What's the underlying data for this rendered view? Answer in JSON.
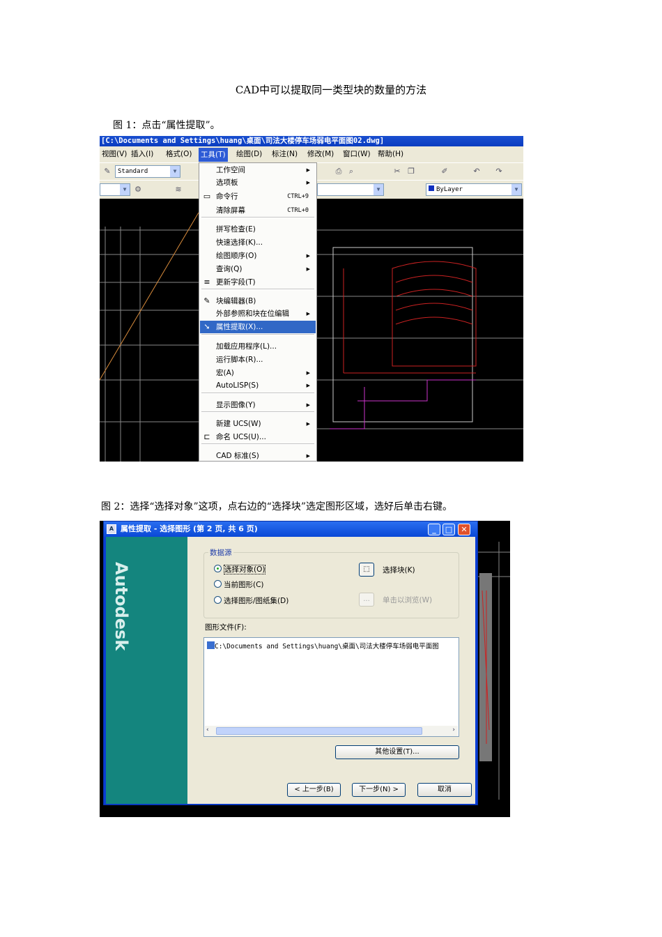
{
  "doc": {
    "title": "CAD中可以提取同一类型块的数量的方法",
    "caption1": "图 1：点击“属性提取”。",
    "caption2": "图 2：选择“选择对象”这项，点右边的“选择块”选定图形区域，选好后单击右键。"
  },
  "fig1": {
    "window_title": "[C:\\Documents and Settings\\huang\\桌面\\司法大楼停车场弱电平面图02.dwg]",
    "menubar": [
      "视图(V)",
      "插入(I)",
      "格式(O)",
      "工具(T)",
      "绘图(D)",
      "标注(N)",
      "修改(M)",
      "窗口(W)",
      "帮助(H)"
    ],
    "text_style": "Standard",
    "layer_color": "ByLayer",
    "menu": [
      {
        "label": "工作空间",
        "arrow": "▶"
      },
      {
        "label": "选项板",
        "arrow": "▶"
      },
      {
        "label": "命令行",
        "shortcut": "CTRL+9"
      },
      {
        "label": "清除屏幕",
        "shortcut": "CTRL+0"
      },
      {
        "label": "拼写检查(E)"
      },
      {
        "label": "快速选择(K)..."
      },
      {
        "label": "绘图顺序(O)",
        "arrow": "▶"
      },
      {
        "label": "查询(Q)",
        "arrow": "▶"
      },
      {
        "label": "更新字段(T)"
      },
      {
        "label": "块编辑器(B)"
      },
      {
        "label": "外部参照和块在位编辑",
        "arrow": "▶"
      },
      {
        "label": "属性提取(X)..."
      },
      {
        "label": "加载应用程序(L)..."
      },
      {
        "label": "运行脚本(R)..."
      },
      {
        "label": "宏(A)",
        "arrow": "▶"
      },
      {
        "label": "AutoLISP(S)",
        "arrow": "▶"
      },
      {
        "label": "显示图像(Y)",
        "arrow": "▶"
      },
      {
        "label": "新建 UCS(W)",
        "arrow": "▶"
      },
      {
        "label": "命名 UCS(U)..."
      },
      {
        "label": "CAD 标准(S)",
        "arrow": "▶"
      }
    ]
  },
  "fig2": {
    "dialog_title": "属性提取 - 选择图形 (第 2 页, 共 6 页)",
    "brand": "Autodesk",
    "group_label": "数据源",
    "radio1": "选择对象(O)",
    "radio2": "当前图形(C)",
    "radio3": "选择图形/图纸集(D)",
    "select_block": "选择块(K)",
    "browse": "单击以浏览(W)",
    "browse_btn": "...",
    "files_label": "图形文件(F):",
    "file_path": "C:\\Documents and Settings\\huang\\桌面\\司法大楼停车场弱电平面图",
    "other_settings": "其他设置(T)...",
    "back": "< 上一步(B)",
    "next": "下一步(N) >",
    "cancel": "取消"
  }
}
